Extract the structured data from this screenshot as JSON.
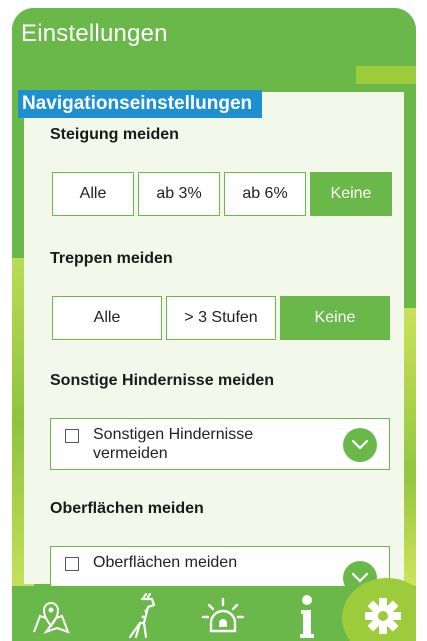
{
  "header": {
    "title": "Einstellungen"
  },
  "section": {
    "title": "Navigationseinstellungen"
  },
  "steigung": {
    "title": "Steigung meiden",
    "options": [
      "Alle",
      "ab 3%",
      "ab 6%",
      "Keine"
    ],
    "selected": "Keine"
  },
  "treppen": {
    "title": "Treppen meiden",
    "options": [
      "Alle",
      "> 3 Stufen",
      "Keine"
    ],
    "selected": "Keine"
  },
  "hindernisse": {
    "title": "Sonstige Hindernisse meiden",
    "checkbox_label": "Sonstigen Hindernisse vermeiden",
    "checked": false
  },
  "oberflaechen": {
    "title": "Oberflächen meiden",
    "checkbox_label": "Oberflächen meiden",
    "checked": false
  },
  "tabbar": {
    "items": [
      {
        "icon": "map-pin-icon"
      },
      {
        "icon": "giraffe-icon"
      },
      {
        "icon": "alarm-light-icon"
      },
      {
        "icon": "info-icon"
      },
      {
        "icon": "gear-icon",
        "active": true
      }
    ]
  },
  "colors": {
    "primary": "#6ab84a",
    "accent": "#9ccc3c",
    "badge": "#1e90d0"
  }
}
